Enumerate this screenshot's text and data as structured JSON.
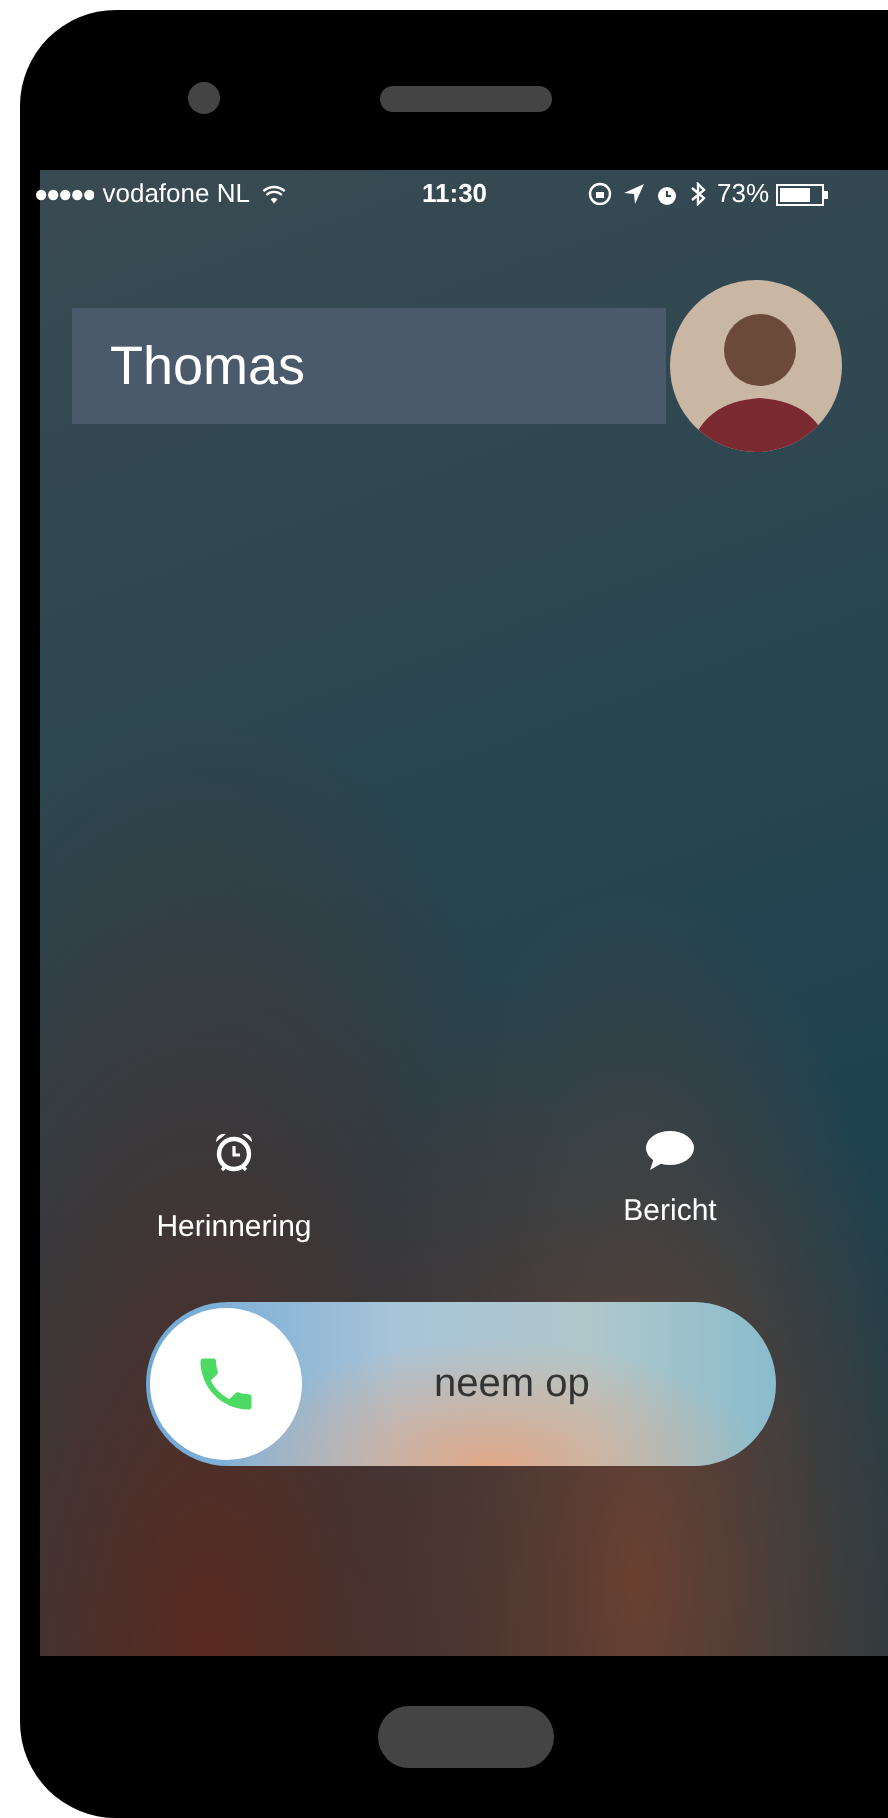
{
  "status_bar": {
    "carrier": "vodafone NL",
    "time": "11:30",
    "battery": "73%"
  },
  "caller": {
    "name": "Thomas"
  },
  "actions": [
    {
      "label": "Herinnering",
      "kind": "alarm"
    },
    {
      "label": "Bericht",
      "kind": "message"
    }
  ],
  "slider": {
    "label": "neem op",
    "level": 0
  }
}
